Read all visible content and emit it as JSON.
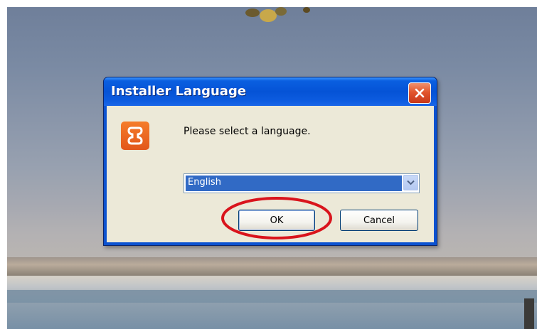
{
  "dialog": {
    "title": "Installer Language",
    "prompt": "Please select a language.",
    "language_select": {
      "selected": "English"
    },
    "buttons": {
      "ok": "OK",
      "cancel": "Cancel"
    }
  },
  "icons": {
    "close": "close-icon",
    "app": "xampp-logo-icon",
    "dropdown": "chevron-down-icon"
  },
  "colors": {
    "titlebar": "#0553d6",
    "close_button": "#e2562d",
    "app_icon": "#f57c2a",
    "selection": "#316ac5",
    "dialog_body": "#ece9d8",
    "annotation": "#d9141c"
  }
}
